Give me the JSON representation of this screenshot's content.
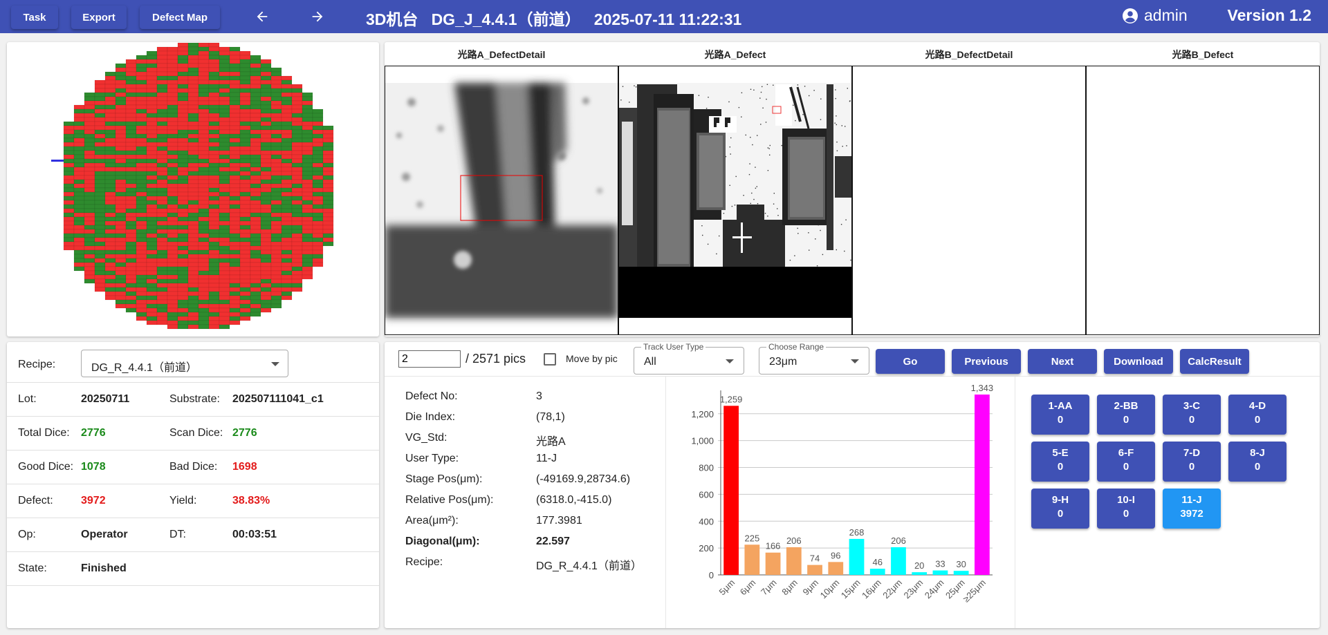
{
  "header": {
    "task_label": "Task",
    "export_label": "Export",
    "defect_map_label": "Defect Map",
    "title": "3D机台   DG_J_4.4.1（前道）   2025-07-11 11:22:31",
    "user": "admin",
    "version": "Version 1.2"
  },
  "images": [
    {
      "title": "光路A_DefectDetail"
    },
    {
      "title": "光路A_Defect"
    },
    {
      "title": "光路B_DefectDetail"
    },
    {
      "title": "光路B_Defect"
    }
  ],
  "info": {
    "recipe_label": "Recipe:",
    "recipe_value": "DG_R_4.4.1（前道）",
    "lot_label": "Lot:",
    "lot_value": "20250711",
    "substrate_label": "Substrate:",
    "substrate_value": "202507111041_c1",
    "total_dice_label": "Total Dice:",
    "total_dice_value": "2776",
    "scan_dice_label": "Scan Dice:",
    "scan_dice_value": "2776",
    "good_dice_label": "Good Dice:",
    "good_dice_value": "1078",
    "bad_dice_label": "Bad Dice:",
    "bad_dice_value": "1698",
    "defect_label": "Defect:",
    "defect_value": "3972",
    "yield_label": "Yield:",
    "yield_value": "38.83%",
    "op_label": "Op:",
    "op_value": "Operator",
    "dt_label": "DT:",
    "dt_value": "00:03:51",
    "state_label": "State:",
    "state_value": "Finished"
  },
  "controls": {
    "page_input_value": "2",
    "total_pics": "/ 2571 pics",
    "move_by_pic_label": "Move by pic",
    "move_by_pic_checked": false,
    "track_user_type_label": "Track User Type",
    "track_user_type_value": "All",
    "choose_range_label": "Choose Range",
    "choose_range_value": "23μm",
    "go_label": "Go",
    "previous_label": "Previous",
    "next_label": "Next",
    "download_label": "Download",
    "calc_result_label": "CalcResult"
  },
  "details": [
    {
      "key": "Defect No:",
      "value": "3",
      "bold": false
    },
    {
      "key": "Die Index:",
      "value": "(78,1)",
      "bold": false
    },
    {
      "key": "VG_Std:",
      "value": "光路A",
      "bold": false
    },
    {
      "key": "User Type:",
      "value": "11-J",
      "bold": false
    },
    {
      "key": "Stage Pos(μm):",
      "value": "(-49169.9,28734.6)",
      "bold": false
    },
    {
      "key": "Relative Pos(μm):",
      "value": "(6318.0,-415.0)",
      "bold": false
    },
    {
      "key": "Area(μm²):",
      "value": "177.3981",
      "bold": false
    },
    {
      "key": "Diagonal(μm):",
      "value": "22.597",
      "bold": true
    },
    {
      "key": "Recipe:",
      "value": "DG_R_4.4.1（前道）",
      "bold": false
    }
  ],
  "chart_data": {
    "type": "bar",
    "categories": [
      "5μm",
      "6μm",
      "7μm",
      "8μm",
      "9μm",
      "10μm",
      "15μm",
      "16μm",
      "22μm",
      "23μm",
      "24μm",
      "25μm",
      "≥25μm"
    ],
    "values": [
      1259,
      225,
      166,
      206,
      74,
      96,
      268,
      46,
      206,
      20,
      33,
      30,
      1343
    ],
    "value_labels": [
      "1,259",
      "225",
      "166",
      "206",
      "74",
      "96",
      "268",
      "46",
      "206",
      "20",
      "33",
      "30",
      "1,343"
    ],
    "colors": [
      "#ff0000",
      "#f4a460",
      "#f4a460",
      "#f4a460",
      "#f4a460",
      "#f4a460",
      "#00ffff",
      "#00ffff",
      "#00ffff",
      "#00ffff",
      "#00ffff",
      "#00ffff",
      "#ff00ff"
    ],
    "yticks": [
      "0",
      "200",
      "400",
      "600",
      "800",
      "1,000",
      "1,200"
    ],
    "ylim": [
      0,
      1343
    ],
    "grid": true,
    "title": "",
    "xlabel": "",
    "ylabel": ""
  },
  "type_buttons": [
    {
      "code": "1-AA",
      "count": "0",
      "active": false
    },
    {
      "code": "2-BB",
      "count": "0",
      "active": false
    },
    {
      "code": "3-C",
      "count": "0",
      "active": false
    },
    {
      "code": "4-D",
      "count": "0",
      "active": false
    },
    {
      "code": "5-E",
      "count": "0",
      "active": false
    },
    {
      "code": "6-F",
      "count": "0",
      "active": false
    },
    {
      "code": "7-D",
      "count": "0",
      "active": false
    },
    {
      "code": "8-J",
      "count": "0",
      "active": false
    },
    {
      "code": "9-H",
      "count": "0",
      "active": false
    },
    {
      "code": "10-I",
      "count": "0",
      "active": false
    },
    {
      "code": "11-J",
      "count": "3972",
      "active": true
    }
  ],
  "colors": {
    "primary": "#3f51b5",
    "active": "#2196f3",
    "good": "#1a8a1a",
    "bad": "#e31b1b"
  }
}
